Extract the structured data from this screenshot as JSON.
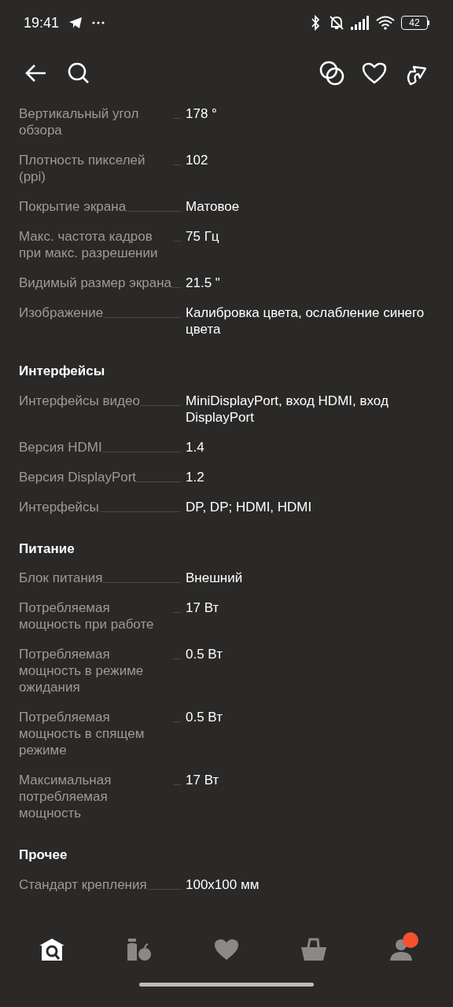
{
  "status_bar": {
    "time": "19:41",
    "battery": "42"
  },
  "sections": [
    {
      "rows": [
        {
          "label": "Вертикальный угол обзора",
          "value": "178 °"
        },
        {
          "label": "Плотность пикселей (ppi)",
          "value": "102"
        },
        {
          "label": "Покрытие экрана",
          "value": "Матовое"
        },
        {
          "label": "Макс. частота кадров при макс. разрешении",
          "value": "75 Гц"
        },
        {
          "label": "Видимый размер экрана",
          "value": "21.5 \""
        },
        {
          "label": "Изображение",
          "value": "Калибровка цвета, ослабление синего цвета"
        }
      ]
    },
    {
      "title": "Интерфейсы",
      "rows": [
        {
          "label": "Интерфейсы видео",
          "value": "MiniDisplayPort, вход HDMI, вход DisplayPort"
        },
        {
          "label": "Версия HDMI",
          "value": "1.4"
        },
        {
          "label": "Версия DisplayPort",
          "value": "1.2"
        },
        {
          "label": "Интерфейсы",
          "value": "DP, DP; HDMI, HDMI"
        }
      ]
    },
    {
      "title": "Питание",
      "rows": [
        {
          "label": "Блок питания",
          "value": "Внешний"
        },
        {
          "label": "Потребляемая мощность при работе",
          "value": "17 Вт"
        },
        {
          "label": "Потребляемая мощность в режиме ожидания",
          "value": "0.5 Вт"
        },
        {
          "label": "Потребляемая мощность в спящем режиме",
          "value": "0.5 Вт"
        },
        {
          "label": "Максимальная потребляемая мощность",
          "value": "17 Вт"
        }
      ]
    },
    {
      "title": "Прочее",
      "rows": [
        {
          "label": "Стандарт крепления",
          "value": "100x100 мм"
        }
      ]
    }
  ],
  "nav": [
    {
      "kind": "home",
      "selected": true,
      "notification": false
    },
    {
      "kind": "groceries",
      "selected": false,
      "notification": false
    },
    {
      "kind": "favorites",
      "selected": false,
      "notification": false
    },
    {
      "kind": "cart",
      "selected": false,
      "notification": false
    },
    {
      "kind": "profile",
      "selected": false,
      "notification": true
    }
  ]
}
